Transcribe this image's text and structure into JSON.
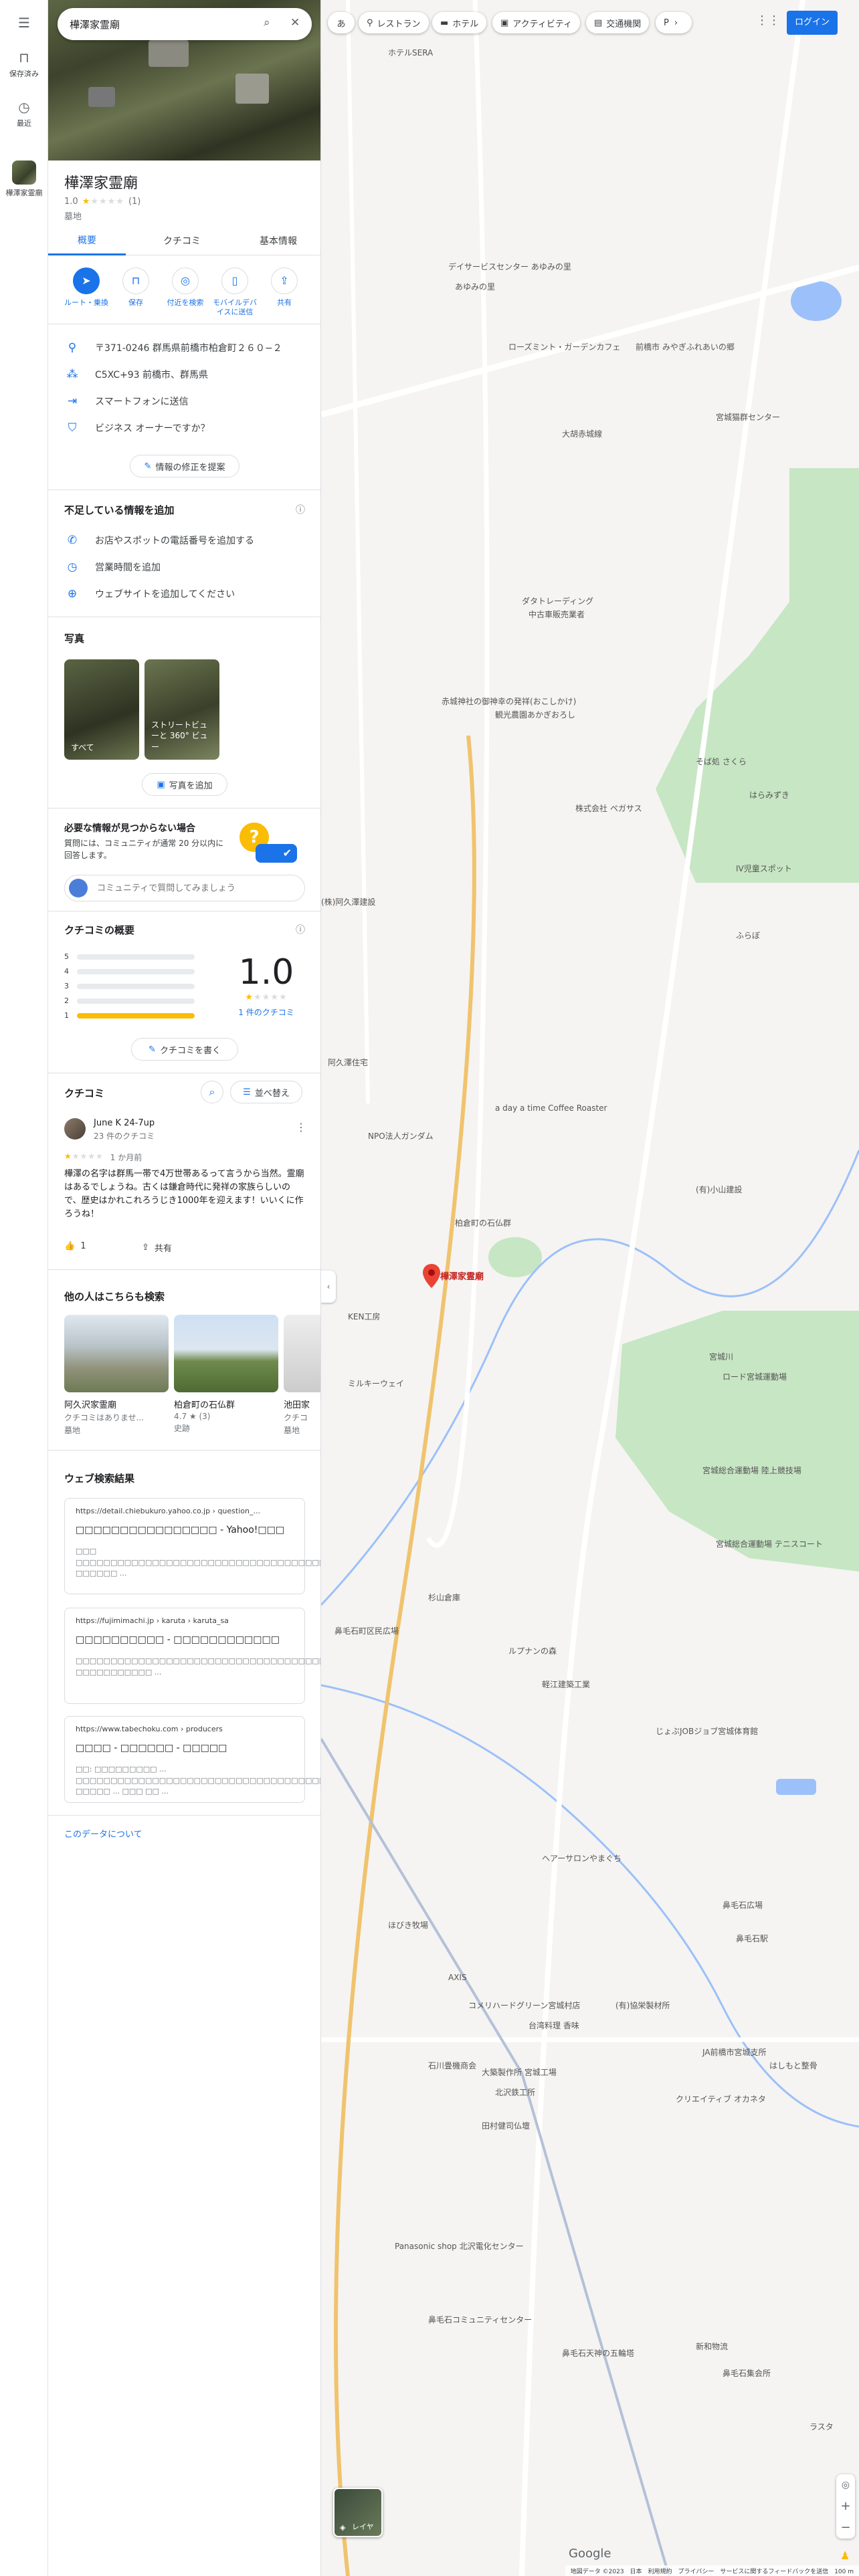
{
  "rail": {
    "saved_label": "保存済み",
    "recent_label": "最近",
    "place_label": "樺澤家霊廟"
  },
  "search": {
    "value": "樺澤家霊廟"
  },
  "place": {
    "name": "樺澤家霊廟",
    "rating": "1.0",
    "stars_filled": 1,
    "review_count": "(1)",
    "category": "墓地"
  },
  "tabs": [
    "概要",
    "クチコミ",
    "基本情報"
  ],
  "actions": [
    {
      "label": "ルート・乗換",
      "icon": "directions-icon"
    },
    {
      "label": "保存",
      "icon": "save-icon"
    },
    {
      "label": "付近を検索",
      "icon": "nearby-icon"
    },
    {
      "label": "モバイルデバイスに送信",
      "icon": "send-to-phone-icon"
    },
    {
      "label": "共有",
      "icon": "share-icon"
    }
  ],
  "info": {
    "address": "〒371-0246 群馬県前橋市柏倉町２６０−２",
    "plus_code": "C5XC+93 前橋市、群馬県",
    "send_phone": "スマートフォンに送信",
    "owner": "ビジネス オーナーですか？",
    "suggest_edit": "情報の修正を提案"
  },
  "missing": {
    "title": "不足している情報を追加",
    "phone": "お店やスポットの電話番号を追加する",
    "hours": "営業時間を追加",
    "website": "ウェブサイトを追加してください"
  },
  "photos": {
    "title": "写真",
    "all": "すべて",
    "street_view": "ストリートビューと 360° ビュー",
    "add": "写真を追加"
  },
  "qa": {
    "title": "必要な情報が見つからない場合",
    "body": "質問には、コミュニティが通常 20 分以内に回答します。",
    "placeholder": "コミュニティで質問してみましょう"
  },
  "review_summary": {
    "title": "クチコミの概要",
    "levels": [
      "5",
      "4",
      "3",
      "2",
      "1"
    ],
    "fractions": [
      0,
      0,
      0,
      0,
      1
    ],
    "score": "1.0",
    "count_link": "1 件のクチコミ",
    "write": "クチコミを書く"
  },
  "reviews": {
    "title": "クチコミ",
    "sort": "並べ替え",
    "author": "June K 24-7up",
    "author_meta": "23 件のクチコミ",
    "time": "1 か月前",
    "text": "樺澤の名字は群馬一帯で4万世帯あるって言うから当然。霊廟はあるでしょうね。古くは鎌倉時代に発祥の家族らしいので、歴史はかれこれろうじき1000年を迎えます！いいくに作ろうね！",
    "likes": "1",
    "share": "共有"
  },
  "also_search": {
    "title": "他の人はこちらも検索",
    "items": [
      {
        "name": "阿久沢家霊廟",
        "meta": "クチコミはありませ...",
        "category": "墓地"
      },
      {
        "name": "柏倉町の石仏群",
        "meta": "4.7 ★ (3)",
        "category": "史跡"
      },
      {
        "name": "池田家",
        "meta": "クチコ",
        "category": "墓地"
      }
    ]
  },
  "web_results": {
    "title": "ウェブ検索結果",
    "items": [
      {
        "url": "https://detail.chiebukuro.yahoo.co.jp › question_...",
        "title": "□□□□□□□□□□□□□□□□ - Yahoo!□□□",
        "snippet": "□□□ □□□□□□□□□□□□□□□□□□□□□□□□□□□□□□□□□□□□□□□□□□□□ □□□□□□ ..."
      },
      {
        "url": "https://fujimimachi.jp › karuta › karuta_sa",
        "title": "□□□□□□□□□□ - □□□□□□□□□□□□",
        "snippet": "□□□□□□□□□□□□□□□□□□□□□□□□□□□□□□□□□□□□□□□□□□□□□ □□□□□□□□□□□ ..."
      },
      {
        "url": "https://www.tabechoku.com › producers",
        "title": "□□□□ - □□□□□□ - □□□□□",
        "snippet": "□□: □□□□□□□□□ ... □□□□□□□□□□□□□□□□□□□□□□□□□□□□□□□□□□□□□ □□□□□ ... □□□ □□ ..."
      }
    ]
  },
  "about_data": "このデータについて",
  "map": {
    "chips": [
      "あ",
      "レストラン",
      "ホテル",
      "アクティビティ",
      "交通機関",
      "P"
    ],
    "login": "ログイン",
    "layers": "レイヤ",
    "google": "Google",
    "footer": "地図データ ©2023　日本　利用規約　プライバシー　サービスに関するフィードバックを送信　100 m",
    "pin_label": "樺澤家霊廟",
    "labels": [
      "ホテルSERA",
      "デイサービスセンター あゆみの里",
      "あゆみの里",
      "ローズミント・ガーデンカフェ",
      "前橋市 みやぎふれあいの郷",
      "宮城猫群センター",
      "大胡赤城線",
      "ダタトレーディング",
      "中古車販売業者",
      "赤城神社の御神幸の発祥(おこしかけ)",
      "観光農園あかぎおろし",
      "株式会社 ペガサス",
      "そば処 さくら",
      "はらみずき",
      "IV児童スポット",
      "ふらぼ",
      "(株)阿久澤建設",
      "阿久澤住宅",
      "a day a time Coffee Roaster",
      "NPO法人ガンダム",
      "柏倉町の石仏群",
      "KEN工房",
      "ミルキーウェイ",
      "宮城川",
      "ロード宮城運動場",
      "宮城総合運動場 陸上競技場",
      "宮城総合運動場 テニスコート",
      "鼻毛石町区民広場",
      "杉山倉庫",
      "ルプナンの森",
      "軽江建築工業",
      "ヘアーサロンやまぐち",
      "鼻毛石広場",
      "鼻毛石駅",
      "コメリハードグリーン宮城村店",
      "台湾料理 香味",
      "(有)協栄製材所",
      "大築製作所 宮城工場",
      "石川畳機商会",
      "北沢鉄工所",
      "Panasonic shop 北沢電化センター",
      "鼻毛石コミュニティセンター",
      "鼻毛石天神の五輪塔",
      "新和物流",
      "鼻毛石集会所",
      "じょぶJOBジョブ宮城体育館",
      "クリエイティブ オカネタ",
      "はしもと整骨",
      "JA前橋市宮城支所",
      "AXIS",
      "田村健司仏壇",
      "ラスタ",
      "(有)小山建設",
      "ほびき牧場"
    ]
  },
  "colors": {
    "accent": "#1a73e8",
    "park": "#c7e6c4",
    "water": "#9cc0f9",
    "pin": "#ea4335",
    "star": "#fbbc04"
  }
}
